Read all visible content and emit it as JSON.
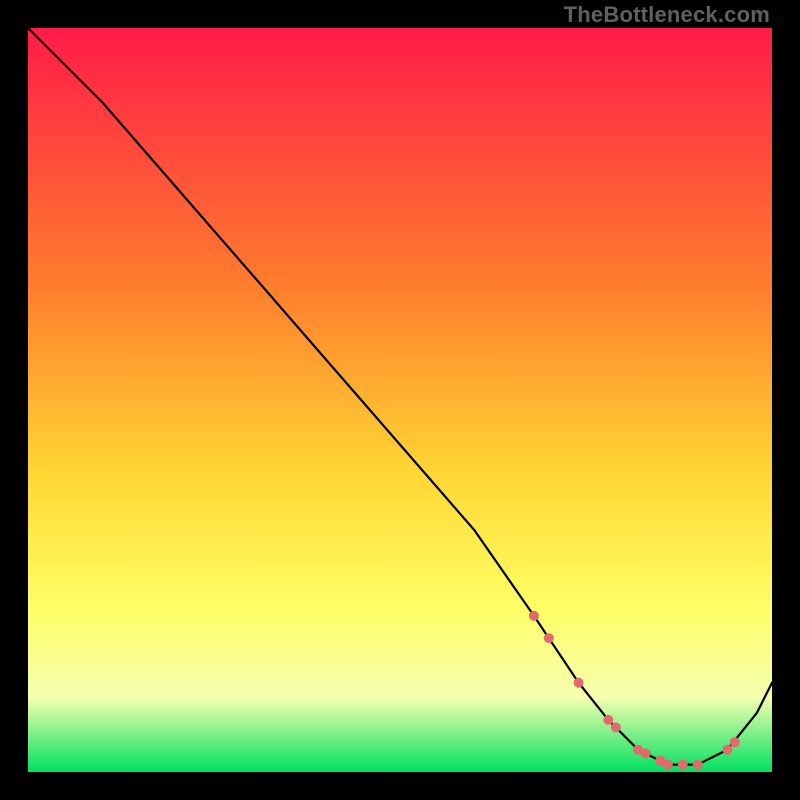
{
  "watermark": "TheBottleneck.com",
  "colors": {
    "bg_black": "#000000",
    "gradient_top": "#ff1b48",
    "gradient_mid1": "#ff7e2d",
    "gradient_mid2": "#ffd733",
    "gradient_mid3": "#ffff66",
    "gradient_mid4": "#f4ffb0",
    "gradient_bottom": "#00e060",
    "curve": "#000000",
    "markers": "#e36a6a"
  },
  "chart_data": {
    "type": "line",
    "title": "",
    "xlabel": "",
    "ylabel": "",
    "xlim": [
      0,
      100
    ],
    "ylim": [
      0,
      100
    ],
    "series": [
      {
        "name": "bottleneck-curve",
        "x": [
          0,
          6,
          10,
          20,
          30,
          40,
          50,
          60,
          68,
          74,
          78,
          82,
          86,
          90,
          94,
          98,
          100
        ],
        "y": [
          100,
          94,
          90,
          78.5,
          67,
          55.5,
          44,
          32.5,
          21,
          12,
          7,
          3,
          1,
          1,
          3,
          8,
          12
        ]
      }
    ],
    "markers": {
      "name": "highlight-dots",
      "x": [
        68,
        70,
        74,
        78,
        79,
        82,
        83,
        85,
        86,
        88,
        90,
        94,
        95
      ],
      "y": [
        21,
        18,
        12,
        7,
        6,
        3,
        2.5,
        1.5,
        1,
        1,
        1,
        3,
        4
      ]
    }
  }
}
